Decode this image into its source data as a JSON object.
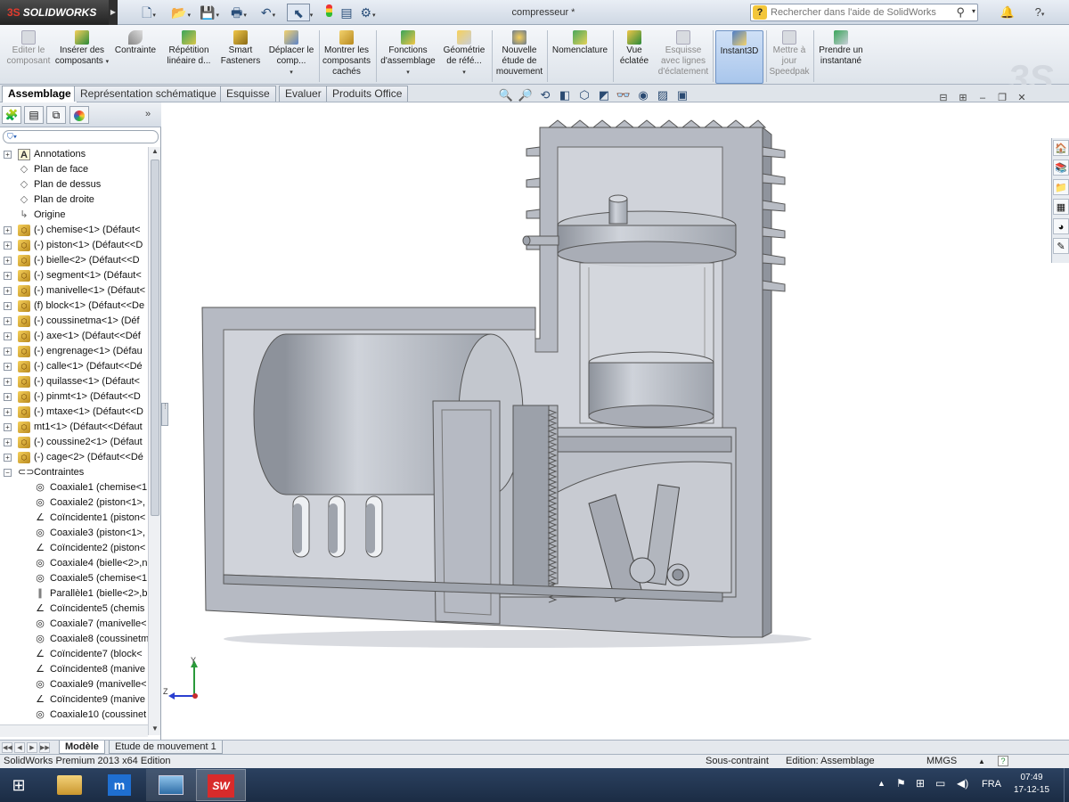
{
  "titlebar": {
    "brand": "SOLIDWORKS",
    "brand_mark": "3S",
    "doc_title": "compresseur *",
    "search_placeholder": "Rechercher dans l'aide de SolidWorks",
    "help_label": "?",
    "quick_icons": [
      "new-icon",
      "open-icon",
      "save-icon",
      "print-icon",
      "undo-icon",
      "select-icon",
      "rebuild-icon",
      "file-props-icon",
      "options-icon"
    ]
  },
  "commands": [
    {
      "label": "Editer le composant",
      "disabled": true,
      "icon": "edit-component-icon"
    },
    {
      "label": "Insérer des composants",
      "disabled": false,
      "icon": "insert-components-icon"
    },
    {
      "label": "Contrainte",
      "disabled": false,
      "icon": "mate-icon"
    },
    {
      "label": "Répétition linéaire d...",
      "disabled": false,
      "icon": "linear-pattern-icon"
    },
    {
      "label": "Smart Fasteners",
      "disabled": false,
      "icon": "smart-fasteners-icon"
    },
    {
      "label": "Déplacer le comp...",
      "disabled": false,
      "icon": "move-component-icon"
    },
    {
      "label": "Montrer les composants cachés",
      "disabled": false,
      "icon": "show-hidden-icon"
    },
    {
      "label": "Fonctions d'assemblage",
      "disabled": false,
      "icon": "assembly-features-icon"
    },
    {
      "label": "Géométrie de réfé...",
      "disabled": false,
      "icon": "reference-geometry-icon"
    },
    {
      "label": "Nouvelle étude de mouvement",
      "disabled": false,
      "icon": "motion-study-icon"
    },
    {
      "label": "Nomenclature",
      "disabled": false,
      "icon": "bom-icon"
    },
    {
      "label": "Vue éclatée",
      "disabled": false,
      "icon": "exploded-view-icon"
    },
    {
      "label": "Esquisse avec lignes d'éclatement",
      "disabled": true,
      "icon": "explode-line-sketch-icon"
    },
    {
      "label": "Instant3D",
      "disabled": false,
      "icon": "instant3d-icon"
    },
    {
      "label": "Mettre à jour Speedpak",
      "disabled": true,
      "icon": "speedpak-icon"
    },
    {
      "label": "Prendre un instantané",
      "disabled": false,
      "icon": "snapshot-icon"
    }
  ],
  "tabs": [
    "Assemblage",
    "Représentation schématique",
    "Esquisse",
    "Evaluer",
    "Produits Office"
  ],
  "tree": [
    {
      "label": "Annotations",
      "icon": "annotations-icon",
      "expander": "+",
      "indent": 0
    },
    {
      "label": "Plan de face",
      "icon": "plane-icon",
      "expander": "",
      "indent": 0
    },
    {
      "label": "Plan de dessus",
      "icon": "plane-icon",
      "expander": "",
      "indent": 0
    },
    {
      "label": "Plan de droite",
      "icon": "plane-icon",
      "expander": "",
      "indent": 0
    },
    {
      "label": "Origine",
      "icon": "origin-icon",
      "expander": "",
      "indent": 0
    },
    {
      "label": "(-) chemise<1> (Défaut<",
      "icon": "part-icon",
      "expander": "+",
      "indent": 0
    },
    {
      "label": "(-) piston<1> (Défaut<<D",
      "icon": "part-icon",
      "expander": "+",
      "indent": 0
    },
    {
      "label": "(-) bielle<2> (Défaut<<D",
      "icon": "part-icon",
      "expander": "+",
      "indent": 0
    },
    {
      "label": "(-) segment<1> (Défaut<",
      "icon": "part-icon",
      "expander": "+",
      "indent": 0
    },
    {
      "label": "(-) manivelle<1> (Défaut<",
      "icon": "part-icon",
      "expander": "+",
      "indent": 0
    },
    {
      "label": "(f) block<1> (Défaut<<De",
      "icon": "part-icon",
      "expander": "+",
      "indent": 0
    },
    {
      "label": "(-) coussinetma<1> (Déf",
      "icon": "part-icon",
      "expander": "+",
      "indent": 0
    },
    {
      "label": "(-) axe<1> (Défaut<<Déf",
      "icon": "part-icon",
      "expander": "+",
      "indent": 0
    },
    {
      "label": "(-) engrenage<1> (Défau",
      "icon": "part-icon",
      "expander": "+",
      "indent": 0
    },
    {
      "label": "(-) calle<1> (Défaut<<Dé",
      "icon": "part-icon",
      "expander": "+",
      "indent": 0
    },
    {
      "label": "(-) quilasse<1> (Défaut<",
      "icon": "part-icon",
      "expander": "+",
      "indent": 0
    },
    {
      "label": "(-) pinmt<1> (Défaut<<D",
      "icon": "part-icon",
      "expander": "+",
      "indent": 0
    },
    {
      "label": "(-) mtaxe<1> (Défaut<<D",
      "icon": "part-icon",
      "expander": "+",
      "indent": 0
    },
    {
      "label": "mt1<1> (Défaut<<Défaut",
      "icon": "part-icon",
      "expander": "+",
      "indent": 0
    },
    {
      "label": "(-) coussine2<1> (Défaut",
      "icon": "part-icon",
      "expander": "+",
      "indent": 0
    },
    {
      "label": "(-) cage<2> (Défaut<<Dé",
      "icon": "part-icon",
      "expander": "+",
      "indent": 0
    },
    {
      "label": "Contraintes",
      "icon": "mates-folder-icon",
      "expander": "−",
      "indent": 0
    },
    {
      "label": "Coaxiale1 (chemise<1",
      "icon": "coaxial-icon",
      "expander": "",
      "indent": 1
    },
    {
      "label": "Coaxiale2 (piston<1>,",
      "icon": "coaxial-icon",
      "expander": "",
      "indent": 1
    },
    {
      "label": "Coïncidente1 (piston<",
      "icon": "coincident-icon",
      "expander": "",
      "indent": 1
    },
    {
      "label": "Coaxiale3 (piston<1>,",
      "icon": "coaxial-icon",
      "expander": "",
      "indent": 1
    },
    {
      "label": "Coïncidente2 (piston<",
      "icon": "coincident-icon",
      "expander": "",
      "indent": 1
    },
    {
      "label": "Coaxiale4 (bielle<2>,n",
      "icon": "coaxial-icon",
      "expander": "",
      "indent": 1
    },
    {
      "label": "Coaxiale5 (chemise<1",
      "icon": "coaxial-icon",
      "expander": "",
      "indent": 1
    },
    {
      "label": "Parallèle1 (bielle<2>,b",
      "icon": "parallel-icon",
      "expander": "",
      "indent": 1
    },
    {
      "label": "Coïncidente5 (chemis",
      "icon": "coincident-icon",
      "expander": "",
      "indent": 1
    },
    {
      "label": "Coaxiale7 (manivelle<",
      "icon": "coaxial-icon",
      "expander": "",
      "indent": 1
    },
    {
      "label": "Coaxiale8 (coussinetm",
      "icon": "coaxial-icon",
      "expander": "",
      "indent": 1
    },
    {
      "label": "Coïncidente7 (block<",
      "icon": "coincident-icon",
      "expander": "",
      "indent": 1
    },
    {
      "label": "Coïncidente8 (manive",
      "icon": "coincident-icon",
      "expander": "",
      "indent": 1
    },
    {
      "label": "Coaxiale9 (manivelle<",
      "icon": "coaxial-icon",
      "expander": "",
      "indent": 1
    },
    {
      "label": "Coïncidente9 (manive",
      "icon": "coincident-icon",
      "expander": "",
      "indent": 1
    },
    {
      "label": "Coaxiale10 (coussinet",
      "icon": "coaxial-icon",
      "expander": "",
      "indent": 1
    }
  ],
  "triad": {
    "y": "Y",
    "z": "Z"
  },
  "bottom_tabs": [
    "Modèle",
    "Etude de mouvement 1"
  ],
  "status": {
    "edition": "SolidWorks Premium 2013 x64 Edition",
    "constraint_state": "Sous-contraint",
    "edit_mode": "Edition: Assemblage",
    "units": "MMGS",
    "help": "?"
  },
  "taskbar": {
    "language": "FRA",
    "time": "07:49",
    "date": "17-12-15",
    "apps": [
      "file-explorer-icon",
      "store-icon",
      "remote-desktop-icon",
      "solidworks-app-icon"
    ]
  },
  "colors": {
    "accent": "#2b63b8",
    "model": "#bcc0c8",
    "taskbar": "#1f3350",
    "brand_red": "#e23b2e"
  }
}
